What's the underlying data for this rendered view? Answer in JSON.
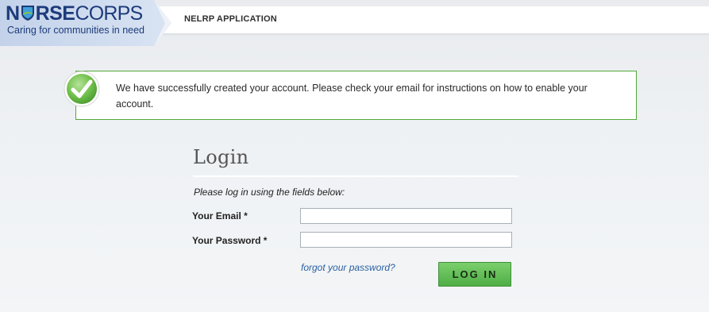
{
  "header": {
    "logo": {
      "brand_left": "N",
      "brand_mid": "RSE",
      "brand_right": "CORPS",
      "tagline": "Caring for communities in need"
    },
    "app_title": "NELRP APPLICATION"
  },
  "notice": {
    "message": "We have successfully created your account. Please check your email for instructions on how to enable your account.",
    "status": "success",
    "icon": "checkmark-icon"
  },
  "login": {
    "title": "Login",
    "instructions": "Please log in using the fields below:",
    "email_label": "Your Email *",
    "email_value": "",
    "password_label": "Your Password *",
    "password_value": "",
    "forgot_link": "forgot your password?",
    "submit_label": "LOG IN"
  },
  "colors": {
    "brand_blue": "#1d3b7a",
    "success_green": "#52a838",
    "button_green": "#5cb74f",
    "link_blue": "#2a5fa0"
  }
}
